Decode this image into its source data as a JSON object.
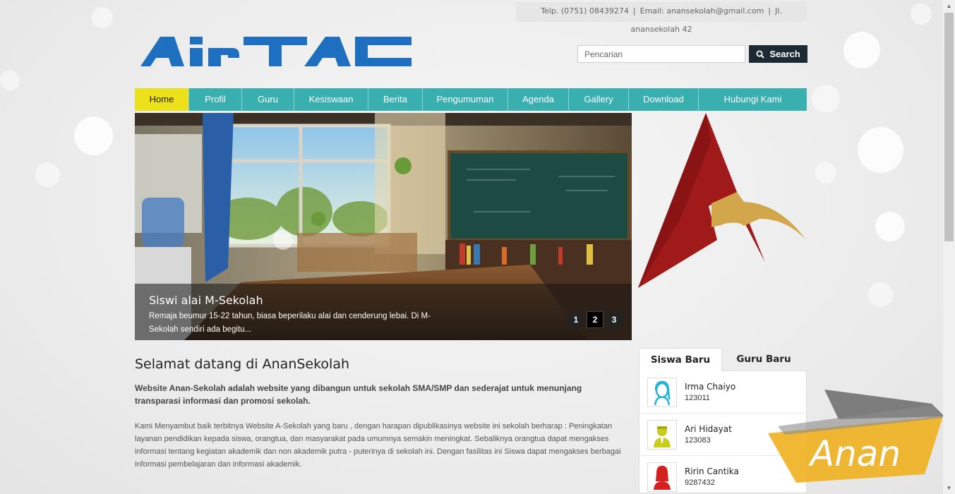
{
  "topbar": {
    "phone": "Telp. (0751) 08439274",
    "email": "Email: anansekolah@gmail.com",
    "address": "Jl. anansekolah 42"
  },
  "logo": {
    "text": "AirTAC",
    "color": "#1e6fbf"
  },
  "search": {
    "placeholder": "Pencarian",
    "button_label": "Search",
    "icon": "search-icon"
  },
  "nav": {
    "items": [
      "Home",
      "Profil",
      "Guru",
      "Kesiswaan",
      "Berita",
      "Pengumuman",
      "Agenda",
      "Gallery",
      "Download",
      "Hubungi Kami"
    ],
    "active": "Home",
    "colors": {
      "bar": "#3aafb0",
      "active": "#ece11a"
    }
  },
  "slider": {
    "title": "Siswi alai M-Sekolah",
    "text": "Remaja beumur 15-22 tahun, biasa beperilaku alai dan cenderung lebai. Di M-Sekolah sendiri ada begitu...",
    "pages": [
      "1",
      "2",
      "3"
    ],
    "active_page": "2"
  },
  "welcome": {
    "title": "Selamat datang di AnanSekolah",
    "lead": "Website Anan-Sekolah adalah website yang dibangun untuk sekolah SMA/SMP dan sederajat untuk menunjang transparasi informasi dan promosi sekolah.",
    "body": "Kami Menyambut baik terbitnya Website A-Sekolah yang baru , dengan harapan dipublikasinya website ini sekolah berharap : Peningkatan layanan pendidikan kepada siswa, orangtua, dan masyarakat pada umumnya semakin meningkat. Sebaliknya orangtua dapat mengakses informasi tentang kegiatan akademik dan non akademik putra - puterinya di sekolah ini. Dengan fasilitas ini Siswa dapat mengakses berbagai informasi pembelajaran dan informasi akademik."
  },
  "tabs": {
    "items": [
      "Siswa Baru",
      "Guru Baru"
    ],
    "active": "Siswa Baru",
    "people": [
      {
        "name": "Irma Chaiyo",
        "id": "123011",
        "avatar_color": "#22b5d8"
      },
      {
        "name": "Ari Hidayat",
        "id": "123083",
        "avatar_color": "#c8cc1a"
      },
      {
        "name": "Ririn Cantika",
        "id": "9287432",
        "avatar_color": "#d42020"
      }
    ]
  },
  "watermark": {
    "text": "Anan"
  }
}
